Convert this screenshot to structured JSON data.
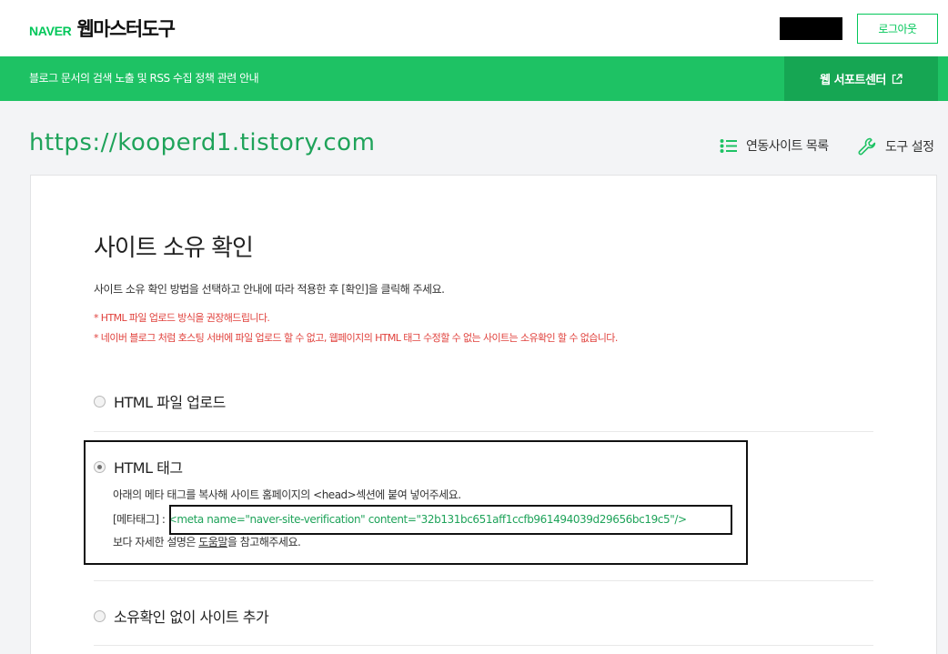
{
  "header": {
    "brand": "NAVER",
    "product": "웹마스터도구",
    "logout_label": "로그아웃"
  },
  "notice_bar": {
    "text": "블로그 문서의 검색 노출 및 RSS 수집 정책 관련 안내",
    "support_label": "웹 서포트센터"
  },
  "site": {
    "url": "https://kooperd1.tistory.com",
    "linked_sites_label": "연동사이트 목록",
    "tool_settings_label": "도구 설정"
  },
  "main": {
    "title": "사이트 소유 확인",
    "description": "사이트 소유 확인 방법을 선택하고 안내에 따라 적용한 후 [확인]을 클릭해 주세요.",
    "warnings": [
      "* HTML 파일 업로드 방식을 권장해드립니다.",
      "* 네이버 블로그 처럼 호스팅 서버에 파일 업로드 할 수 없고, 웹페이지의 HTML 태그 수정할 수 없는 사이트는 소유확인 할 수 없습니다."
    ],
    "options": [
      {
        "label": "HTML 파일 업로드",
        "selected": false
      },
      {
        "label": "HTML 태그",
        "selected": true
      },
      {
        "label": "소유확인 없이 사이트 추가",
        "selected": false
      }
    ],
    "html_tag": {
      "instruction": "아래의 메타 태그를 복사해 사이트 홈페이지의 <head>섹션에 붙여 넣어주세요.",
      "meta_prefix": "[메타태그] : ",
      "meta_code": "<meta name=\"naver-site-verification\" content=\"32b131bc651aff1ccfb961494039d29656bc19c5\"/>",
      "help_prefix": "보다 자세한 설명은 ",
      "help_link": "도움말",
      "help_suffix": "을 참고해주세요."
    }
  },
  "colors": {
    "brand_green": "#03c75a",
    "bar_green": "#1ec264",
    "support_green": "#16a653",
    "warning_red": "#e0413c"
  }
}
